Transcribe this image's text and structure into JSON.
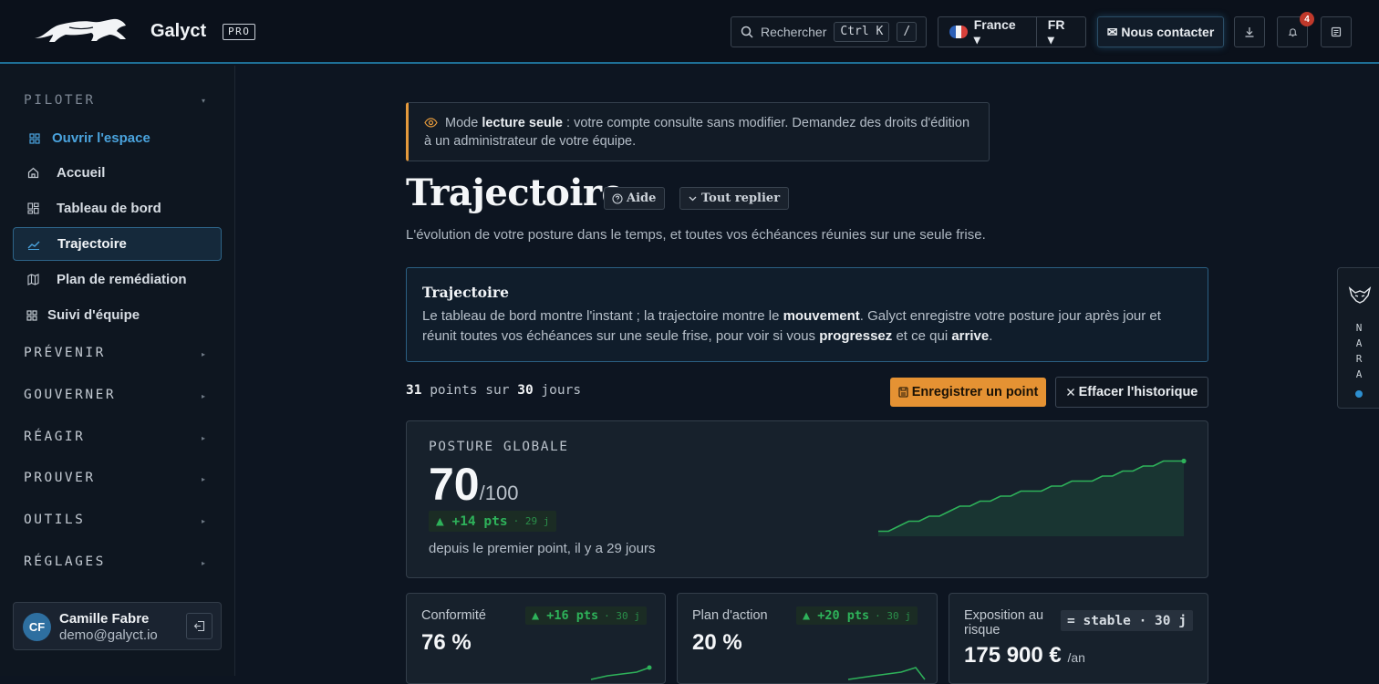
{
  "header": {
    "brand": "Galyct",
    "plan_badge": "PRO",
    "search": {
      "placeholder": "Rechercher",
      "shortcut": "Ctrl K",
      "shortcut_alt": "/"
    },
    "country": "France ▾",
    "language": "FR ▾",
    "contact_label": "✉ Nous contacter",
    "notifications_count": "4"
  },
  "sidebar": {
    "sections": [
      {
        "label": "PILOTER",
        "caret": "▾"
      },
      {
        "label": "PRÉVENIR",
        "caret": "▸"
      },
      {
        "label": "GOUVERNER",
        "caret": "▸"
      },
      {
        "label": "RÉAGIR",
        "caret": "▸"
      },
      {
        "label": "PROUVER",
        "caret": "▸"
      },
      {
        "label": "OUTILS",
        "caret": "▸"
      },
      {
        "label": "RÉGLAGES",
        "caret": "▸"
      }
    ],
    "items": [
      {
        "label": "Ouvrir l'espace"
      },
      {
        "label": "Accueil"
      },
      {
        "label": "Tableau de bord"
      },
      {
        "label": "Trajectoire"
      },
      {
        "label": "Plan de remédiation"
      },
      {
        "label": "Suivi d'équipe"
      }
    ],
    "user": {
      "initials": "CF",
      "name": "Camille Fabre",
      "email": "demo@galyct.io"
    }
  },
  "alert": {
    "prefix": "Mode ",
    "bold": "lecture seule",
    "rest": " : votre compte consulte sans modifier. Demandez des droits d'édition à un administrateur de votre équipe."
  },
  "page": {
    "title": "Trajectoire",
    "help_label": "Aide",
    "collapse_label": "Tout replier",
    "subtitle": "L'évolution de votre posture dans le temps, et toutes vos échéances réunies sur une seule frise."
  },
  "info": {
    "title": "Trajectoire",
    "p1": "Le tableau de bord montre l'instant ; la trajectoire montre le ",
    "b1": "mouvement",
    "p2": ". Galyct enregistre votre posture jour après jour et réunit toutes vos échéances sur une seule frise, pour voir si vous ",
    "b2": "progressez",
    "p3": " et ce qui ",
    "b3": "arrive",
    "p4": "."
  },
  "history": {
    "points": "31",
    "points_label": " points sur ",
    "days": "30",
    "days_label": " jours",
    "save_label": "Enregistrer un point",
    "clear_label": "Effacer l'historique"
  },
  "posture": {
    "label": "POSTURE GLOBALE",
    "value": "70",
    "max": "/100",
    "delta": "▲ +14 pts",
    "delta_period": "· 29 j",
    "since": "depuis le premier point, il y a 29 jours",
    "series": [
      56,
      56,
      57,
      58,
      58,
      59,
      59,
      60,
      61,
      61,
      62,
      62,
      63,
      63,
      64,
      64,
      64,
      65,
      65,
      66,
      66,
      66,
      67,
      67,
      68,
      68,
      69,
      69,
      70,
      70,
      70
    ]
  },
  "kpis": [
    {
      "label": "Conformité",
      "value": "76 %",
      "delta": "▲ +16 pts",
      "period": "· 30 j"
    },
    {
      "label": "Plan d'action",
      "value": "20 %",
      "delta": "▲ +20 pts",
      "period": "· 30 j"
    },
    {
      "label": "Exposition au risque",
      "value": "175 900 €",
      "unit": "/an",
      "delta": "= stable · 30 j"
    }
  ],
  "nara": {
    "letters": "NARA"
  },
  "colors": {
    "accent": "#e59233",
    "link": "#4aa3dd",
    "positive": "#2eb25a",
    "alert_border": "#e59a3c"
  }
}
